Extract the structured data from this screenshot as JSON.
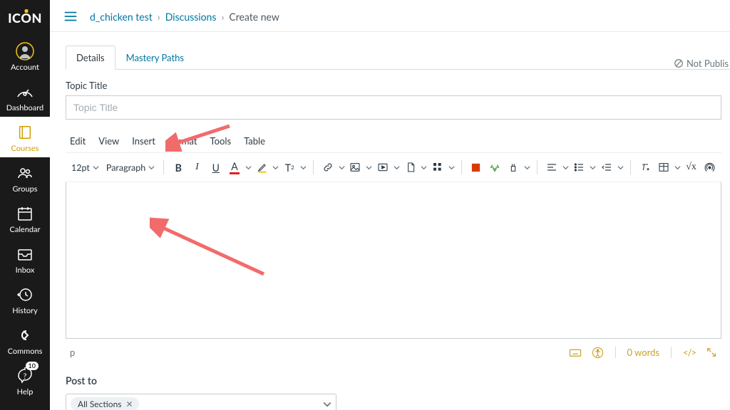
{
  "logo_text": {
    "pre": "IC",
    "mid": "O",
    "post": "N"
  },
  "nav": {
    "account": "Account",
    "dashboard": "Dashboard",
    "courses": "Courses",
    "groups": "Groups",
    "calendar": "Calendar",
    "inbox": "Inbox",
    "history": "History",
    "commons": "Commons",
    "help": "Help",
    "help_badge": "10"
  },
  "breadcrumb": {
    "course": "d_chicken test",
    "section": "Discussions",
    "current": "Create new"
  },
  "tabs": {
    "details": "Details",
    "mastery": "Mastery Paths"
  },
  "publish_status": "Not Publis",
  "form": {
    "title_label": "Topic Title",
    "title_placeholder": "Topic Title"
  },
  "editor": {
    "menu": {
      "edit": "Edit",
      "view": "View",
      "insert": "Insert",
      "format": "Format",
      "tools": "Tools",
      "table": "Table"
    },
    "font_size": "12pt",
    "block": "Paragraph",
    "status_path": "p",
    "word_count": "0 words",
    "html_view": "</>"
  },
  "postto": {
    "label": "Post to",
    "chip": "All Sections"
  }
}
